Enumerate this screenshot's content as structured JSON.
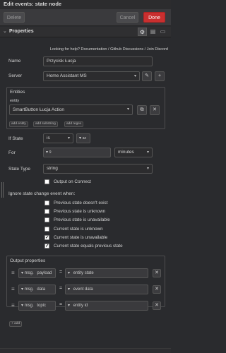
{
  "title": "Edit events: state node",
  "toolbar": {
    "delete": "Delete",
    "cancel": "Cancel",
    "done": "Done"
  },
  "properties": {
    "label": "Properties",
    "help": "Looking for help? Documentation / Github Discussions / Join Discord"
  },
  "form": {
    "name_label": "Name",
    "name_value": "Przycisk Łucja",
    "server_label": "Server",
    "server_value": "Home Assistant MS",
    "entities_label": "Entities",
    "entity_label": "entity",
    "entity_value": "SmartButton Łucja Action",
    "chips": [
      "add entity",
      "add substring",
      "add regex"
    ],
    "if_state_label": "If State",
    "if_state_op": "is",
    "if_state_type": "az",
    "for_label": "For",
    "for_type": "9",
    "for_unit": "minutes",
    "state_type_label": "State Type",
    "state_type_value": "string",
    "output_on_connect": "Output on Connect",
    "ignore_label": "Ignore state change event when:",
    "ignore_options": [
      {
        "label": "Previous state doesn't exist",
        "checked": false
      },
      {
        "label": "Previous state is unknown",
        "checked": false
      },
      {
        "label": "Previous state is unavailable",
        "checked": false
      },
      {
        "label": "Current state is unknown",
        "checked": false
      },
      {
        "label": "Current state is unavailable",
        "checked": true
      },
      {
        "label": "Current state equals previous state",
        "checked": true
      }
    ]
  },
  "output": {
    "label": "Output properties",
    "rows": [
      {
        "prefix": "msg.",
        "prop": "payload",
        "value": "entity state"
      },
      {
        "prefix": "msg.",
        "prop": "data",
        "value": "event data"
      },
      {
        "prefix": "msg.",
        "prop": "topic",
        "value": "entity id"
      }
    ],
    "add": "add"
  }
}
